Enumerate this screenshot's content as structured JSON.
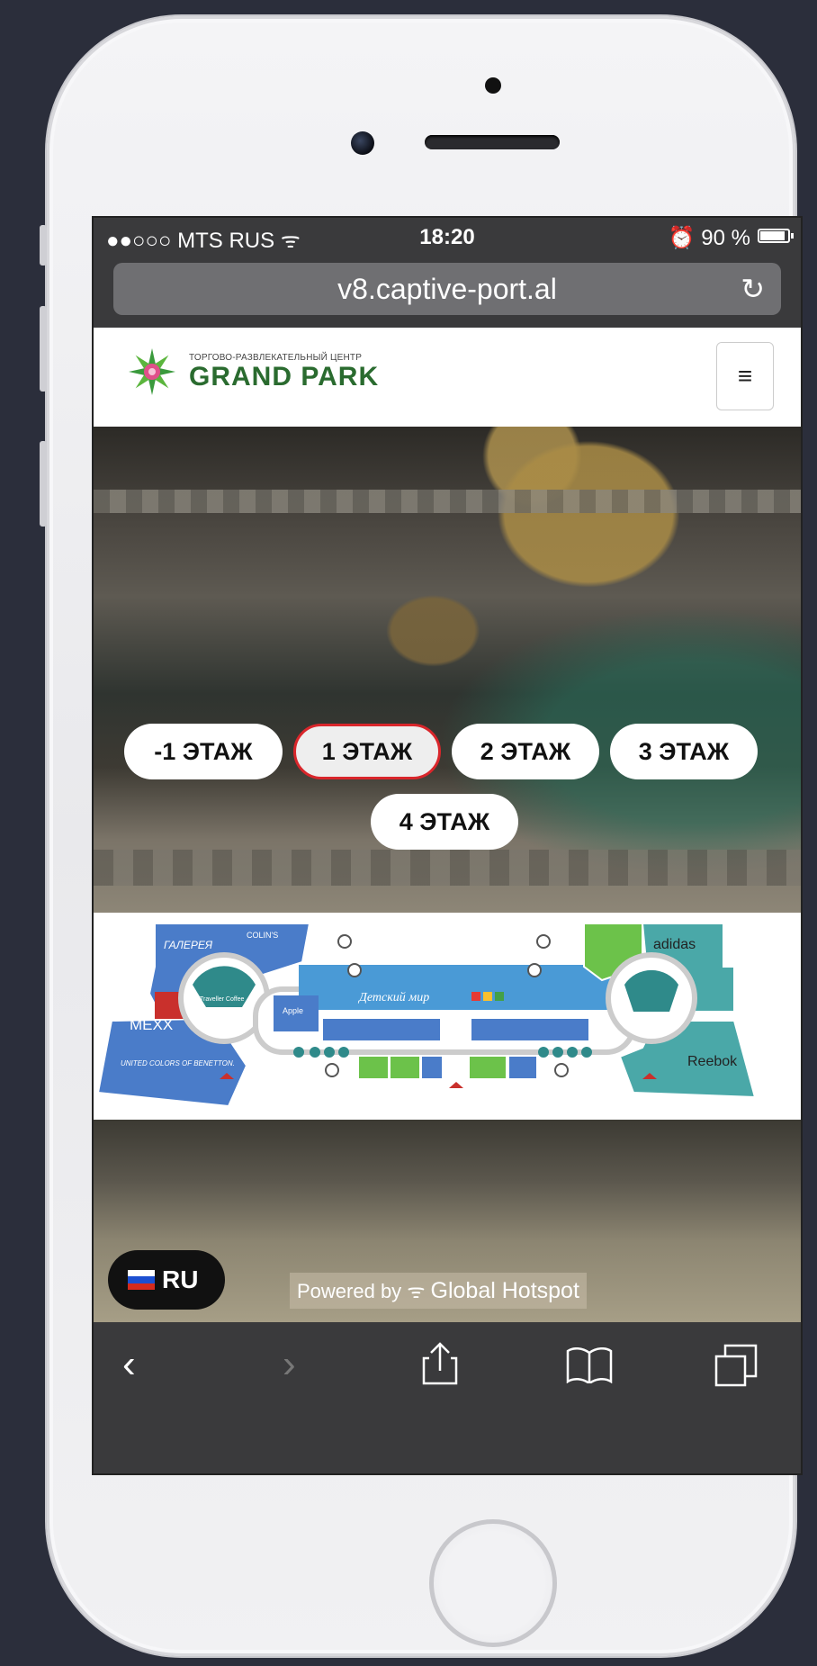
{
  "status_bar": {
    "carrier": "●●○○○ MTS RUS ᯤ",
    "time": "18:20",
    "battery": "⏰ 90 %",
    "battery_level": 0.9
  },
  "browser": {
    "url": "v8.captive-port.al",
    "reload_icon": "reload-icon"
  },
  "site": {
    "logo_small": "ТОРГОВО-РАЗВЛЕКАТЕЛЬНЫЙ ЦЕНТР",
    "logo_big": "GRAND PARK",
    "menu_icon": "≡"
  },
  "floors": {
    "items": [
      {
        "label": "-1 ЭТАЖ",
        "active": false
      },
      {
        "label": "1 ЭТАЖ",
        "active": true
      },
      {
        "label": "2 ЭТАЖ",
        "active": false
      },
      {
        "label": "3 ЭТАЖ",
        "active": false
      },
      {
        "label": "4 ЭТАЖ",
        "active": false
      }
    ]
  },
  "map": {
    "stores": {
      "galereya": "ГАЛЕРЕЯ",
      "colins": "COLIN'S",
      "mexx": "MEXX",
      "benetton": "UNITED COLORS OF BENETTON.",
      "apple": "Apple",
      "detsky_mir": "Детский мир",
      "adidas": "adidas",
      "reebok": "Reebok",
      "traveller": "Traveller Coffee"
    }
  },
  "footer": {
    "language": "RU",
    "powered_by": "Powered by",
    "brand": "Global Hotspot"
  },
  "toolbar": {
    "back": "‹",
    "forward": "›",
    "share": "share-icon",
    "bookmarks": "bookmarks-icon",
    "tabs": "tabs-icon"
  },
  "colors": {
    "accent_active": "#d9262b",
    "brand_green": "#2a6b2f",
    "map_blue": "#4a7cc9",
    "map_teal": "#4aa8a8",
    "map_green": "#6cc24a"
  }
}
